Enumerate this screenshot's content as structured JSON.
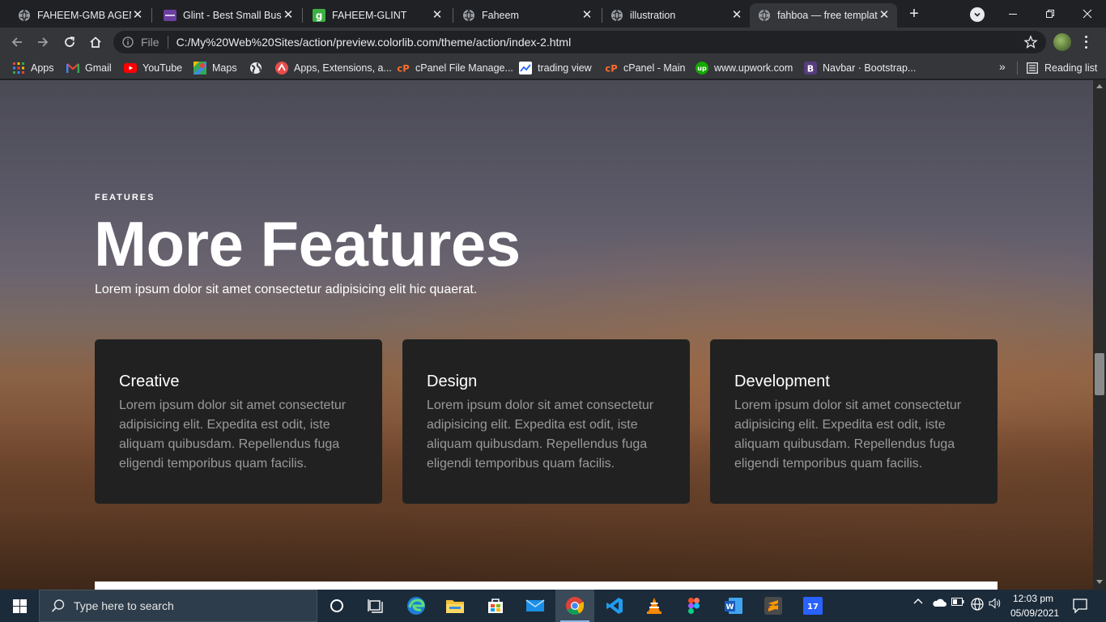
{
  "browser": {
    "tabs": [
      {
        "title": "FAHEEM-GMB AGENCY",
        "icon": "globe-icon"
      },
      {
        "title": "Glint - Best Small Busin",
        "icon": "colorlib-icon"
      },
      {
        "title": "FAHEEM-GLINT",
        "icon": "glint-g-icon"
      },
      {
        "title": "Faheem",
        "icon": "globe-icon"
      },
      {
        "title": "illustration",
        "icon": "globe-icon"
      },
      {
        "title": "fahboa — free templat",
        "icon": "globe-icon",
        "active": true
      }
    ],
    "new_tab_label": "+",
    "close_label": "✕",
    "address": {
      "scheme_label": "File",
      "url": "C:/My%20Web%20Sites/action/preview.colorlib.com/theme/action/index-2.html"
    },
    "bookmarks": [
      {
        "label": "Apps",
        "icon": "apps-grid-icon"
      },
      {
        "label": "Gmail",
        "icon": "gmail-icon"
      },
      {
        "label": "YouTube",
        "icon": "youtube-icon"
      },
      {
        "label": "Maps",
        "icon": "maps-icon"
      },
      {
        "label": "",
        "icon": "globe-icon"
      },
      {
        "label": "Apps, Extensions, a...",
        "icon": "extensions-icon"
      },
      {
        "label": "cPanel File Manage...",
        "icon": "cpanel-icon"
      },
      {
        "label": "trading view",
        "icon": "tradingview-icon"
      },
      {
        "label": "cPanel - Main",
        "icon": "cpanel-icon"
      },
      {
        "label": "www.upwork.com",
        "icon": "upwork-icon"
      },
      {
        "label": "Navbar · Bootstrap...",
        "icon": "bootstrap-icon"
      }
    ],
    "more_label": "»",
    "reading_list_label": "Reading list"
  },
  "page": {
    "eyebrow": "FEATURES",
    "title": "More Features",
    "subtitle": "Lorem ipsum dolor sit amet consectetur adipisicing elit hic quaerat.",
    "cards": [
      {
        "title": "Creative",
        "body": "Lorem ipsum dolor sit amet consectetur adipisicing elit. Expedita est odit, iste aliquam quibusdam. Repellendus fuga eligendi temporibus quam facilis."
      },
      {
        "title": "Design",
        "body": "Lorem ipsum dolor sit amet consectetur adipisicing elit. Expedita est odit, iste aliquam quibusdam. Repellendus fuga eligendi temporibus quam facilis."
      },
      {
        "title": "Development",
        "body": "Lorem ipsum dolor sit amet consectetur adipisicing elit. Expedita est odit, iste aliquam quibusdam. Repellendus fuga eligendi temporibus quam facilis."
      }
    ]
  },
  "taskbar": {
    "search_placeholder": "Type here to search",
    "time": "12:03 pm",
    "date": "05/09/2021"
  },
  "colors": {
    "tab_bg": "#202124",
    "toolbar_bg": "#35363a",
    "card_bg": "#212121",
    "taskbar_bg": "#1c2b3a"
  }
}
